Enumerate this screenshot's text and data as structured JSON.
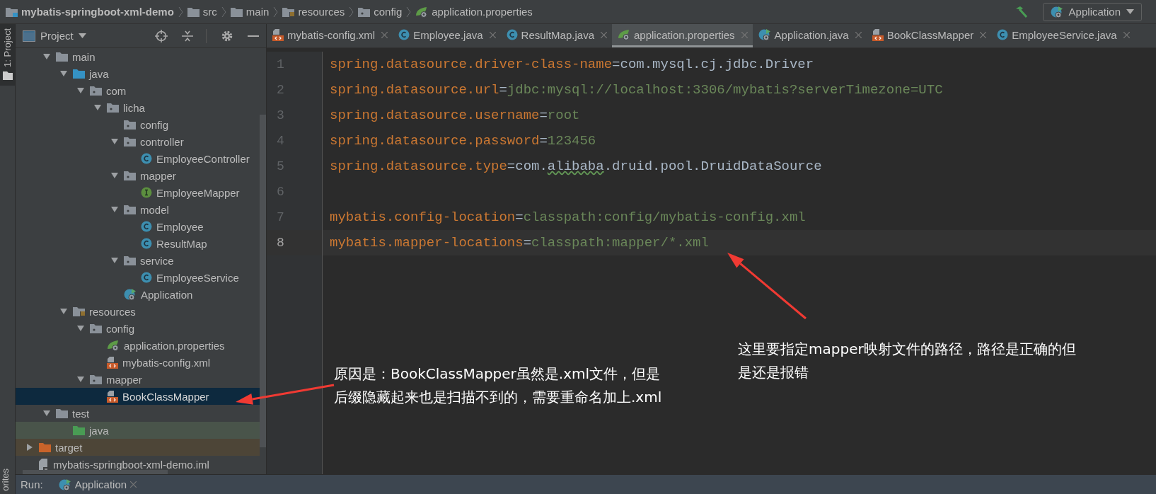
{
  "breadcrumb": [
    {
      "label": "mybatis-springboot-xml-demo",
      "kind": "module"
    },
    {
      "label": "src",
      "kind": "folder"
    },
    {
      "label": "main",
      "kind": "folder"
    },
    {
      "label": "resources",
      "kind": "resources"
    },
    {
      "label": "config",
      "kind": "package"
    },
    {
      "label": "application.properties",
      "kind": "properties"
    }
  ],
  "run_config": {
    "label": "Application"
  },
  "side_strip": {
    "project_tab": "1: Project",
    "favorites_tab": "orites"
  },
  "project_panel": {
    "title": "Project"
  },
  "tree": {
    "continued": [
      {
        "label": "main",
        "kind": "folder",
        "selected": false,
        "expanded": true,
        "children": [
          {
            "label": "java",
            "kind": "source",
            "selected": false,
            "expanded": true,
            "children": [
              {
                "label": "com",
                "kind": "package",
                "selected": false,
                "expanded": true,
                "children": [
                  {
                    "label": "licha",
                    "kind": "package",
                    "selected": false,
                    "expanded": true,
                    "children": [
                      {
                        "label": "config",
                        "kind": "package",
                        "selected": false
                      },
                      {
                        "label": "controller",
                        "kind": "package",
                        "selected": false,
                        "expanded": true,
                        "children": [
                          {
                            "label": "EmployeeController",
                            "kind": "class",
                            "selected": false
                          }
                        ]
                      },
                      {
                        "label": "mapper",
                        "kind": "package",
                        "selected": false,
                        "expanded": true,
                        "children": [
                          {
                            "label": "EmployeeMapper",
                            "kind": "interface",
                            "selected": false
                          }
                        ]
                      },
                      {
                        "label": "model",
                        "kind": "package",
                        "selected": false,
                        "expanded": true,
                        "children": [
                          {
                            "label": "Employee",
                            "kind": "class",
                            "selected": false
                          },
                          {
                            "label": "ResultMap",
                            "kind": "class",
                            "selected": false
                          }
                        ]
                      },
                      {
                        "label": "service",
                        "kind": "package",
                        "selected": false,
                        "expanded": true,
                        "children": [
                          {
                            "label": "EmployeeService",
                            "kind": "class",
                            "selected": false
                          }
                        ]
                      },
                      {
                        "label": "Application",
                        "kind": "app",
                        "selected": false
                      }
                    ]
                  }
                ]
              }
            ]
          },
          {
            "label": "resources",
            "kind": "resources",
            "selected": false,
            "expanded": true,
            "children": [
              {
                "label": "config",
                "kind": "package",
                "selected": false,
                "expanded": true,
                "children": [
                  {
                    "label": "application.properties",
                    "kind": "properties",
                    "selected": false
                  },
                  {
                    "label": "mybatis-config.xml",
                    "kind": "xml",
                    "selected": false
                  }
                ]
              },
              {
                "label": "mapper",
                "kind": "package",
                "selected": false,
                "expanded": true,
                "children": [
                  {
                    "label": "BookClassMapper",
                    "kind": "xml",
                    "selected": true
                  }
                ]
              }
            ]
          }
        ]
      },
      {
        "label": "test",
        "kind": "folder",
        "selected": false,
        "expanded": true,
        "children": [
          {
            "label": "java",
            "kind": "test",
            "selected": false
          }
        ]
      }
    ],
    "items": [
      {
        "label": "target",
        "kind": "excluded",
        "selected": false,
        "expanded": false
      },
      {
        "label": "mybatis-springboot-xml-demo.iml",
        "kind": "iml",
        "selected": false
      }
    ]
  },
  "tabs": [
    {
      "label": "mybatis-config.xml",
      "kind": "xml",
      "selected": false
    },
    {
      "label": "Employee.java",
      "kind": "class",
      "selected": false
    },
    {
      "label": "ResultMap.java",
      "kind": "class",
      "selected": false
    },
    {
      "label": "application.properties",
      "kind": "properties",
      "selected": true
    },
    {
      "label": "Application.java",
      "kind": "app",
      "selected": false
    },
    {
      "label": "BookClassMapper",
      "kind": "xml",
      "selected": false
    },
    {
      "label": "EmployeeService.java",
      "kind": "class",
      "selected": false
    }
  ],
  "editor": {
    "lines": [
      {
        "number": "1",
        "key": "spring.datasource.driver-class-name",
        "separator": "=",
        "value": [
          {
            "text": "com.mysql.cj.jdbc.Driver",
            "kind": "class"
          }
        ],
        "current": false
      },
      {
        "number": "2",
        "key": "spring.datasource.url",
        "separator": "=",
        "value": [
          {
            "text": "jdbc:mysql://localhost:3306/mybatis?serverTimezone=UTC",
            "kind": "string"
          }
        ],
        "current": false
      },
      {
        "number": "3",
        "key": "spring.datasource.username",
        "separator": "=",
        "value": [
          {
            "text": "root",
            "kind": "string"
          }
        ],
        "current": false
      },
      {
        "number": "4",
        "key": "spring.datasource.password",
        "separator": "=",
        "value": [
          {
            "text": "123456",
            "kind": "string"
          }
        ],
        "current": false
      },
      {
        "number": "5",
        "key": "spring.datasource.type",
        "separator": "=",
        "value": [
          {
            "text": "com.",
            "kind": "class"
          },
          {
            "text": "alibaba",
            "kind": "typo"
          },
          {
            "text": ".druid.pool.DruidDataSource",
            "kind": "class"
          }
        ],
        "current": false
      },
      {
        "number": "6",
        "current": false
      },
      {
        "number": "7",
        "key": "mybatis.config-location",
        "separator": "=",
        "value": [
          {
            "text": "classpath:config/mybatis-config.xml",
            "kind": "string"
          }
        ],
        "current": false
      },
      {
        "number": "8",
        "key": "mybatis.mapper-locations",
        "separator": "=",
        "value": [
          {
            "text": "classpath:mapper/*.xml",
            "kind": "string"
          }
        ],
        "current": true
      }
    ]
  },
  "annotations": [
    {
      "lines": [
        "原因是：BookClassMapper虽然是.xml文件，但是",
        "后缀隐藏起来也是扫描不到的，需要重命名加上.xml"
      ]
    },
    {
      "lines": [
        "这里要指定mapper映射文件的路径，路径是正确的但",
        "是还是报错"
      ]
    }
  ],
  "run_bar": {
    "label": "Run:",
    "tab": "Application"
  }
}
